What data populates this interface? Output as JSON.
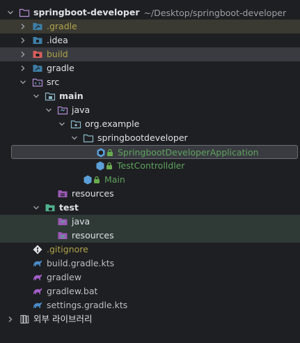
{
  "project": {
    "name": "springboot-developer",
    "path": "~/Desktop/springboot-developer"
  },
  "items": {
    "gradle_hidden": ".gradle",
    "idea": ".idea",
    "build": "build",
    "gradle": "gradle",
    "src": "src",
    "main": "main",
    "java_main": "java",
    "org_example": "org.example",
    "springbootdeveloper": "springbootdeveloper",
    "app_class": "SpringbootDeveloperApplication",
    "controller_class": "TestControlldler",
    "main_class": "Main",
    "resources_main": "resources",
    "test": "test",
    "java_test": "java",
    "resources_test": "resources",
    "gitignore": ".gitignore",
    "build_gradle": "build.gradle.kts",
    "gradlew": "gradlew",
    "gradlew_bat": "gradlew.bat",
    "settings_gradle": "settings.gradle.kts",
    "external_libs": "외부 라이브러리"
  },
  "colors": {
    "background": "#1e1f22",
    "selection_row": "#393b40",
    "excluded_text": "#b0a44a",
    "test_text_green": "#5fa35f"
  }
}
